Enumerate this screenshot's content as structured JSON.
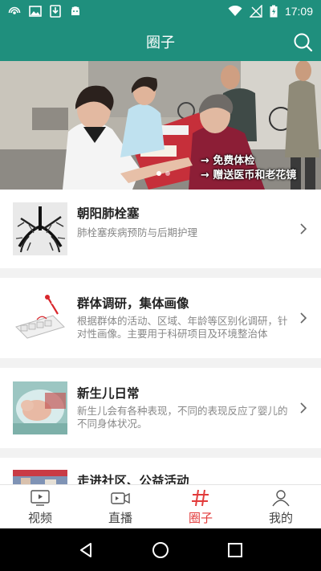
{
  "status_bar": {
    "time": "17:09"
  },
  "app_bar": {
    "title": "圈子"
  },
  "banner": {
    "captions": [
      "→ 免费体检",
      "→ 赠送医币和老花镜"
    ],
    "slide_count": 2,
    "active_slide": 1
  },
  "items": [
    {
      "title": "朝阳肺栓塞",
      "description": "肺栓塞疾病预防与后期护理",
      "image": "lung-xray-thumbnail"
    },
    {
      "title": "群体调研，集体画像",
      "description": "根据群体的活动、区域、年龄等区别化调研，针对性画像。主要用于科研项目及环境整治体",
      "image": "survey-cards-thumbnail"
    },
    {
      "title": "新生儿日常",
      "description": "新生儿会有各种表现，不同的表现反应了婴儿的不同身体状况。",
      "image": "newborn-thumbnail"
    },
    {
      "title": "走进社区、公益活动",
      "description": "",
      "image": "community-thumbnail"
    }
  ],
  "bottom_nav": {
    "items": [
      {
        "label": "视频",
        "icon": "video-icon"
      },
      {
        "label": "直播",
        "icon": "live-camera-icon"
      },
      {
        "label": "圈子",
        "icon": "hash-icon"
      },
      {
        "label": "我的",
        "icon": "person-icon"
      }
    ],
    "active_index": 2
  },
  "colors": {
    "primary": "#1f8f7d",
    "active_tab": "#e23b3b"
  }
}
